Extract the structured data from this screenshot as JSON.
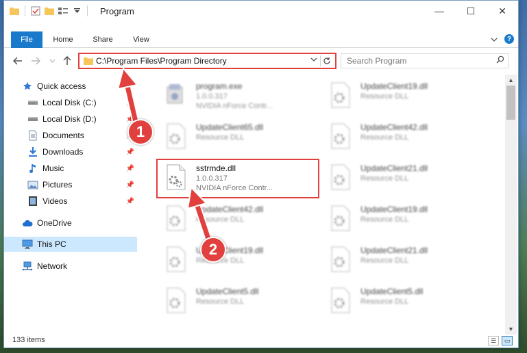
{
  "window": {
    "title": "Program"
  },
  "controls": {
    "minimize": "—",
    "maximize": "☐",
    "close": "✕"
  },
  "ribbon": {
    "tabs": [
      "File",
      "Home",
      "Share",
      "View"
    ],
    "help": "?"
  },
  "address": {
    "path": "C:\\Program Files\\Program Directory"
  },
  "search": {
    "placeholder": "Search Program"
  },
  "sidebar": {
    "items": [
      {
        "label": "Quick access",
        "icon": "star-icon",
        "pinned": false
      },
      {
        "label": "Local Disk (C:)",
        "icon": "drive-icon",
        "pinned": true
      },
      {
        "label": "Local Disk (D:)",
        "icon": "drive-icon",
        "pinned": true
      },
      {
        "label": "Documents",
        "icon": "documents-icon",
        "pinned": true
      },
      {
        "label": "Downloads",
        "icon": "download-icon",
        "pinned": true
      },
      {
        "label": "Music",
        "icon": "music-icon",
        "pinned": true
      },
      {
        "label": "Pictures",
        "icon": "pictures-icon",
        "pinned": true
      },
      {
        "label": "Videos",
        "icon": "videos-icon",
        "pinned": true
      },
      {
        "label": "OneDrive",
        "icon": "cloud-icon",
        "pinned": false
      },
      {
        "label": "This PC",
        "icon": "monitor-icon",
        "pinned": false
      },
      {
        "label": "Network",
        "icon": "network-icon",
        "pinned": false
      }
    ]
  },
  "files": [
    {
      "name": "program.exe",
      "line1": "1.0.0.317",
      "line2": "NVIDIA nForce Contr...",
      "kind": "exe",
      "blurred": true
    },
    {
      "name": "UpdateClient19.dll",
      "line1": "Resource DLL",
      "line2": "",
      "kind": "dll",
      "blurred": true
    },
    {
      "name": "UpdateClient65.dll",
      "line1": "Resource DLL",
      "line2": "",
      "kind": "dll",
      "blurred": true
    },
    {
      "name": "UpdateClient42.dll",
      "line1": "Resource DLL",
      "line2": "",
      "kind": "dll",
      "blurred": true
    },
    {
      "name": "sstrmde.dll",
      "line1": "1.0.0.317",
      "line2": "NVIDIA nForce Contr...",
      "kind": "dll",
      "blurred": false
    },
    {
      "name": "UpdateClient21.dll",
      "line1": "Resource DLL",
      "line2": "",
      "kind": "dll",
      "blurred": true
    },
    {
      "name": "UpdateClient42.dll",
      "line1": "Resource DLL",
      "line2": "",
      "kind": "dll",
      "blurred": true
    },
    {
      "name": "UpdateClient19.dll",
      "line1": "Resource DLL",
      "line2": "",
      "kind": "dll",
      "blurred": true
    },
    {
      "name": "UpdateClient19.dll",
      "line1": "Resource DLL",
      "line2": "",
      "kind": "dll",
      "blurred": true
    },
    {
      "name": "UpdateClient21.dll",
      "line1": "Resource DLL",
      "line2": "",
      "kind": "dll",
      "blurred": true
    },
    {
      "name": "UpdateClient5.dll",
      "line1": "Resource DLL",
      "line2": "",
      "kind": "dll",
      "blurred": true
    },
    {
      "name": "UpdateClient5.dll",
      "line1": "Resource DLL",
      "line2": "",
      "kind": "dll",
      "blurred": true
    }
  ],
  "status": {
    "count": "133 items"
  },
  "annotations": {
    "badge1": "1",
    "badge2": "2",
    "color": "#e2403f"
  }
}
